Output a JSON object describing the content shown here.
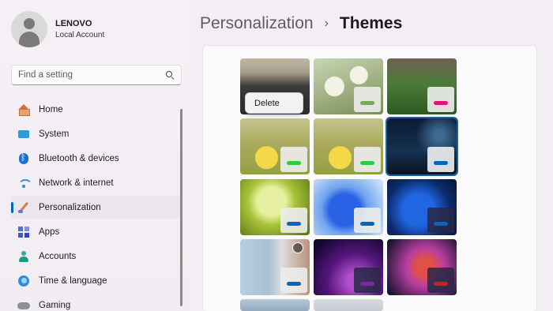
{
  "profile": {
    "name": "LENOVO",
    "account_type": "Local Account"
  },
  "search": {
    "placeholder": "Find a setting"
  },
  "nav": {
    "items": [
      {
        "label": "Home",
        "icon": "home-icon"
      },
      {
        "label": "System",
        "icon": "system-icon"
      },
      {
        "label": "Bluetooth & devices",
        "icon": "bluetooth-icon"
      },
      {
        "label": "Network & internet",
        "icon": "wifi-icon"
      },
      {
        "label": "Personalization",
        "icon": "brush-icon",
        "active": true
      },
      {
        "label": "Apps",
        "icon": "apps-icon"
      },
      {
        "label": "Accounts",
        "icon": "person-icon"
      },
      {
        "label": "Time & language",
        "icon": "globe-clock-icon"
      },
      {
        "label": "Gaming",
        "icon": "controller-icon"
      }
    ]
  },
  "header": {
    "parent": "Personalization",
    "separator": "›",
    "current": "Themes"
  },
  "themes": {
    "accents": [
      "#7ca85a",
      "#7ca85a",
      "#e0157a",
      "#2ecc40",
      "#2ecc40",
      "#0067c0",
      "#0067c0",
      "#0067c0",
      "#0067c0",
      "#0067c0",
      "#7a2a9a",
      "#c81f2a"
    ],
    "selected_index": 5
  },
  "context_menu": {
    "delete_label": "Delete"
  },
  "colors": {
    "accent": "#0067c0",
    "background": "#f3eef3",
    "card": "#fbfafb"
  }
}
